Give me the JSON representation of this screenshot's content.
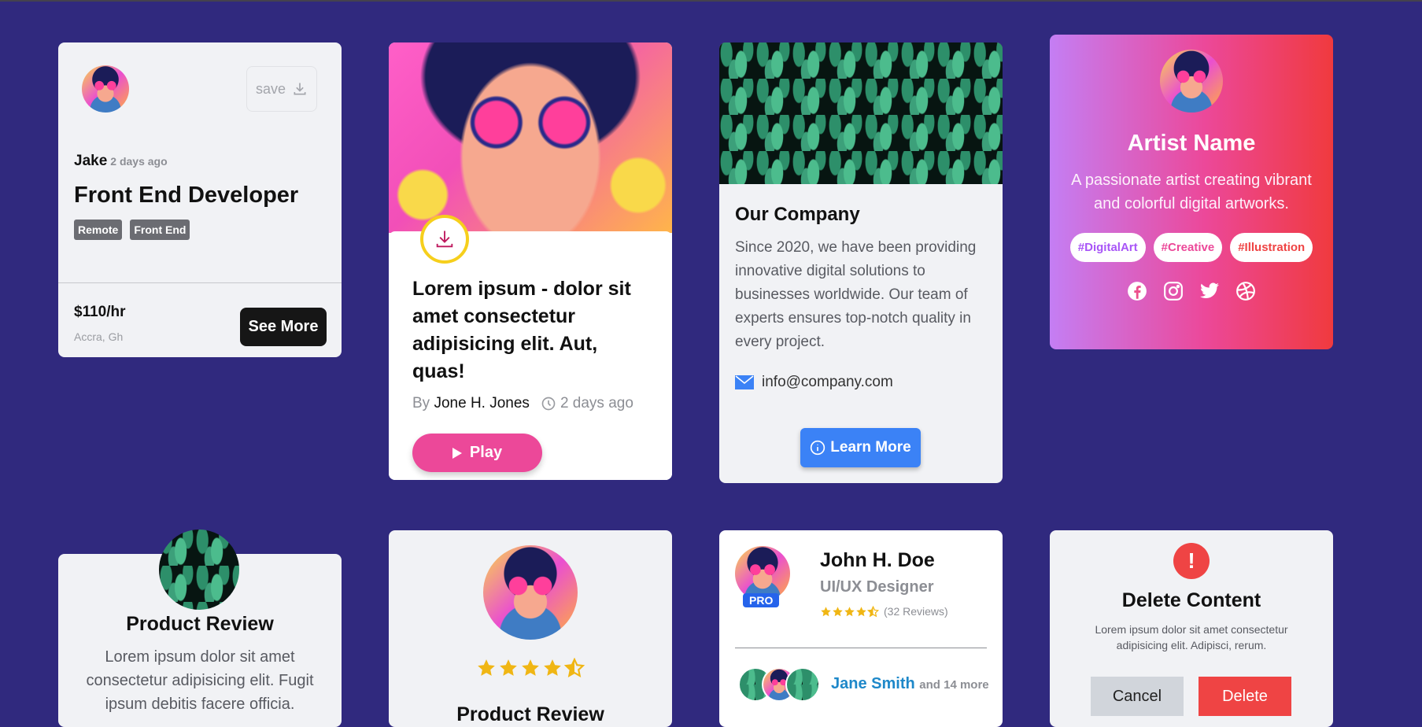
{
  "colors": {
    "background": "#30297e",
    "pink": "#ec4899",
    "blue": "#3b82f6",
    "red": "#ef4444",
    "star": "#f0b614"
  },
  "job_card": {
    "save_label": "save",
    "user_name": "Jake",
    "posted": "2 days ago",
    "title": "Front End Developer",
    "tags": [
      "Remote",
      "Front End"
    ],
    "rate": "$110/hr",
    "location": "Accra, Gh",
    "cta": "See More"
  },
  "post_card": {
    "title": "Lorem ipsum - dolor sit amet consectetur adipisicing elit. Aut, quas!",
    "by_prefix": "By",
    "author": "Jone H. Jones",
    "time": "2 days ago",
    "play_label": "Play"
  },
  "company_card": {
    "title": "Our Company",
    "description": "Since 2020, we have been providing innovative digital solutions to businesses worldwide. Our team of experts ensures top-notch quality in every project.",
    "email": "info@company.com",
    "cta": "Learn More"
  },
  "artist_card": {
    "name": "Artist Name",
    "bio": "A passionate artist creating vibrant and colorful digital artworks.",
    "tags": [
      {
        "label": "#DigitalArt",
        "color": "#a855f7"
      },
      {
        "label": "#Creative",
        "color": "#ec4899"
      },
      {
        "label": "#Illustration",
        "color": "#ef4444"
      }
    ],
    "social_icons": [
      "facebook-icon",
      "instagram-icon",
      "twitter-icon",
      "dribbble-icon"
    ]
  },
  "product_review_1": {
    "title": "Product Review",
    "description": "Lorem ipsum dolor sit amet consectetur adipisicing elit. Fugit ipsum debitis facere officia."
  },
  "product_review_2": {
    "rating": 4.5,
    "title": "Product Review"
  },
  "profile_card": {
    "badge": "PRO",
    "name": "John H. Doe",
    "role": "UI/UX Designer",
    "rating": 4.5,
    "reviews": "(32 Reviews)",
    "friend_name": "Jane Smith",
    "friend_more": "and 14 more"
  },
  "delete_card": {
    "icon": "!",
    "title": "Delete Content",
    "description": "Lorem ipsum dolor sit amet consectetur adipisicing elit. Adipisci, rerum.",
    "cancel": "Cancel",
    "delete": "Delete"
  }
}
